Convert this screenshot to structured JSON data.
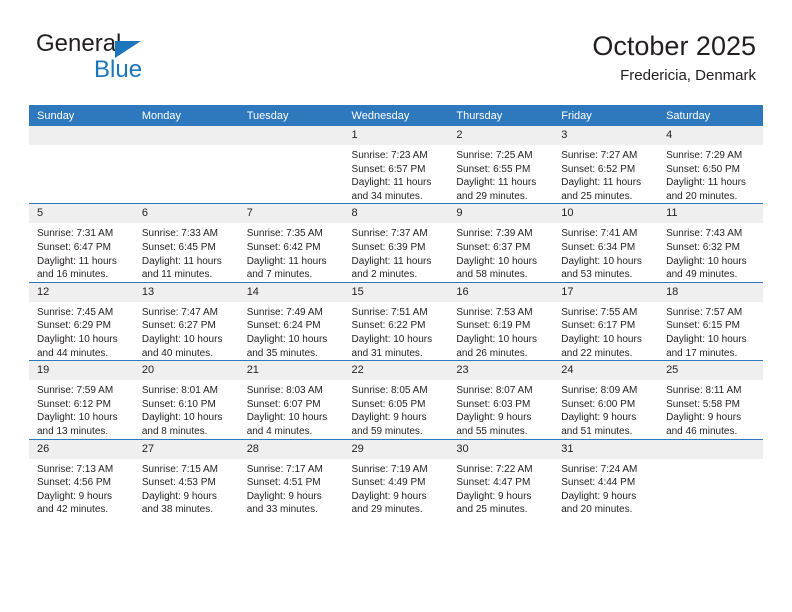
{
  "brand": {
    "name_part1": "General",
    "name_part2": "Blue",
    "triangle_color": "#1c76bc"
  },
  "header": {
    "title": "October 2025",
    "subtitle": "Fredericia, Denmark"
  },
  "calendar": {
    "header_background": "#2e78bd",
    "daynum_background": "#efefef",
    "weekday_headers": [
      "Sunday",
      "Monday",
      "Tuesday",
      "Wednesday",
      "Thursday",
      "Friday",
      "Saturday"
    ],
    "labels": {
      "sunrise_prefix": "Sunrise:",
      "sunset_prefix": "Sunset:",
      "daylight_prefix": "Daylight:"
    },
    "weeks": [
      [
        {
          "day": "",
          "lines": []
        },
        {
          "day": "",
          "lines": []
        },
        {
          "day": "",
          "lines": []
        },
        {
          "day": "1",
          "lines": [
            "Sunrise: 7:23 AM",
            "Sunset: 6:57 PM",
            "Daylight: 11 hours and 34 minutes."
          ]
        },
        {
          "day": "2",
          "lines": [
            "Sunrise: 7:25 AM",
            "Sunset: 6:55 PM",
            "Daylight: 11 hours and 29 minutes."
          ]
        },
        {
          "day": "3",
          "lines": [
            "Sunrise: 7:27 AM",
            "Sunset: 6:52 PM",
            "Daylight: 11 hours and 25 minutes."
          ]
        },
        {
          "day": "4",
          "lines": [
            "Sunrise: 7:29 AM",
            "Sunset: 6:50 PM",
            "Daylight: 11 hours and 20 minutes."
          ]
        }
      ],
      [
        {
          "day": "5",
          "lines": [
            "Sunrise: 7:31 AM",
            "Sunset: 6:47 PM",
            "Daylight: 11 hours and 16 minutes."
          ]
        },
        {
          "day": "6",
          "lines": [
            "Sunrise: 7:33 AM",
            "Sunset: 6:45 PM",
            "Daylight: 11 hours and 11 minutes."
          ]
        },
        {
          "day": "7",
          "lines": [
            "Sunrise: 7:35 AM",
            "Sunset: 6:42 PM",
            "Daylight: 11 hours and 7 minutes."
          ]
        },
        {
          "day": "8",
          "lines": [
            "Sunrise: 7:37 AM",
            "Sunset: 6:39 PM",
            "Daylight: 11 hours and 2 minutes."
          ]
        },
        {
          "day": "9",
          "lines": [
            "Sunrise: 7:39 AM",
            "Sunset: 6:37 PM",
            "Daylight: 10 hours and 58 minutes."
          ]
        },
        {
          "day": "10",
          "lines": [
            "Sunrise: 7:41 AM",
            "Sunset: 6:34 PM",
            "Daylight: 10 hours and 53 minutes."
          ]
        },
        {
          "day": "11",
          "lines": [
            "Sunrise: 7:43 AM",
            "Sunset: 6:32 PM",
            "Daylight: 10 hours and 49 minutes."
          ]
        }
      ],
      [
        {
          "day": "12",
          "lines": [
            "Sunrise: 7:45 AM",
            "Sunset: 6:29 PM",
            "Daylight: 10 hours and 44 minutes."
          ]
        },
        {
          "day": "13",
          "lines": [
            "Sunrise: 7:47 AM",
            "Sunset: 6:27 PM",
            "Daylight: 10 hours and 40 minutes."
          ]
        },
        {
          "day": "14",
          "lines": [
            "Sunrise: 7:49 AM",
            "Sunset: 6:24 PM",
            "Daylight: 10 hours and 35 minutes."
          ]
        },
        {
          "day": "15",
          "lines": [
            "Sunrise: 7:51 AM",
            "Sunset: 6:22 PM",
            "Daylight: 10 hours and 31 minutes."
          ]
        },
        {
          "day": "16",
          "lines": [
            "Sunrise: 7:53 AM",
            "Sunset: 6:19 PM",
            "Daylight: 10 hours and 26 minutes."
          ]
        },
        {
          "day": "17",
          "lines": [
            "Sunrise: 7:55 AM",
            "Sunset: 6:17 PM",
            "Daylight: 10 hours and 22 minutes."
          ]
        },
        {
          "day": "18",
          "lines": [
            "Sunrise: 7:57 AM",
            "Sunset: 6:15 PM",
            "Daylight: 10 hours and 17 minutes."
          ]
        }
      ],
      [
        {
          "day": "19",
          "lines": [
            "Sunrise: 7:59 AM",
            "Sunset: 6:12 PM",
            "Daylight: 10 hours and 13 minutes."
          ]
        },
        {
          "day": "20",
          "lines": [
            "Sunrise: 8:01 AM",
            "Sunset: 6:10 PM",
            "Daylight: 10 hours and 8 minutes."
          ]
        },
        {
          "day": "21",
          "lines": [
            "Sunrise: 8:03 AM",
            "Sunset: 6:07 PM",
            "Daylight: 10 hours and 4 minutes."
          ]
        },
        {
          "day": "22",
          "lines": [
            "Sunrise: 8:05 AM",
            "Sunset: 6:05 PM",
            "Daylight: 9 hours and 59 minutes."
          ]
        },
        {
          "day": "23",
          "lines": [
            "Sunrise: 8:07 AM",
            "Sunset: 6:03 PM",
            "Daylight: 9 hours and 55 minutes."
          ]
        },
        {
          "day": "24",
          "lines": [
            "Sunrise: 8:09 AM",
            "Sunset: 6:00 PM",
            "Daylight: 9 hours and 51 minutes."
          ]
        },
        {
          "day": "25",
          "lines": [
            "Sunrise: 8:11 AM",
            "Sunset: 5:58 PM",
            "Daylight: 9 hours and 46 minutes."
          ]
        }
      ],
      [
        {
          "day": "26",
          "lines": [
            "Sunrise: 7:13 AM",
            "Sunset: 4:56 PM",
            "Daylight: 9 hours and 42 minutes."
          ]
        },
        {
          "day": "27",
          "lines": [
            "Sunrise: 7:15 AM",
            "Sunset: 4:53 PM",
            "Daylight: 9 hours and 38 minutes."
          ]
        },
        {
          "day": "28",
          "lines": [
            "Sunrise: 7:17 AM",
            "Sunset: 4:51 PM",
            "Daylight: 9 hours and 33 minutes."
          ]
        },
        {
          "day": "29",
          "lines": [
            "Sunrise: 7:19 AM",
            "Sunset: 4:49 PM",
            "Daylight: 9 hours and 29 minutes."
          ]
        },
        {
          "day": "30",
          "lines": [
            "Sunrise: 7:22 AM",
            "Sunset: 4:47 PM",
            "Daylight: 9 hours and 25 minutes."
          ]
        },
        {
          "day": "31",
          "lines": [
            "Sunrise: 7:24 AM",
            "Sunset: 4:44 PM",
            "Daylight: 9 hours and 20 minutes."
          ]
        },
        {
          "day": "",
          "lines": []
        }
      ]
    ]
  }
}
